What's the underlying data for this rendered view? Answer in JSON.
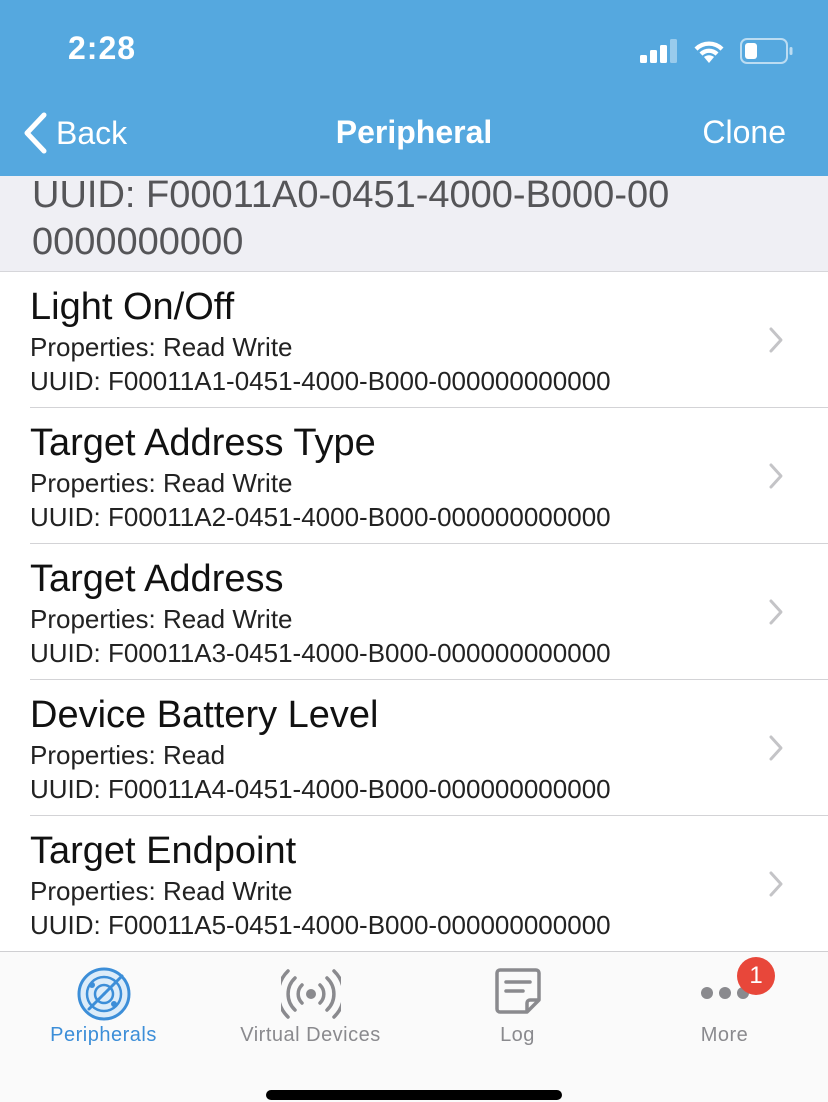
{
  "status": {
    "time": "2:28",
    "signal_icon": "cellular-signal-icon",
    "wifi_icon": "wifi-icon",
    "battery_icon": "battery-icon"
  },
  "nav": {
    "back_label": "Back",
    "title": "Peripheral",
    "clone_label": "Clone"
  },
  "section": {
    "header": "UUID: F00011A0-0451-4000-B000-000000000000"
  },
  "characteristics": [
    {
      "title": "Light On/Off",
      "properties": "Properties: Read Write",
      "uuid": "UUID: F00011A1-0451-4000-B000-000000000000"
    },
    {
      "title": "Target Address Type",
      "properties": "Properties: Read Write",
      "uuid": "UUID: F00011A2-0451-4000-B000-000000000000"
    },
    {
      "title": "Target Address",
      "properties": "Properties: Read Write",
      "uuid": "UUID: F00011A3-0451-4000-B000-000000000000"
    },
    {
      "title": "Device Battery Level",
      "properties": "Properties: Read",
      "uuid": "UUID: F00011A4-0451-4000-B000-000000000000"
    },
    {
      "title": "Target Endpoint",
      "properties": "Properties: Read Write",
      "uuid": "UUID: F00011A5-0451-4000-B000-000000000000"
    }
  ],
  "tabs": [
    {
      "label": "Peripherals",
      "icon": "radar-icon",
      "active": true
    },
    {
      "label": "Virtual Devices",
      "icon": "broadcast-icon",
      "active": false
    },
    {
      "label": "Log",
      "icon": "log-icon",
      "active": false
    },
    {
      "label": "More",
      "icon": "more-icon",
      "active": false,
      "badge": "1"
    }
  ],
  "colors": {
    "nav_bar": "#55a8df",
    "active_tab": "#3c8ed8",
    "badge": "#e8473a"
  }
}
